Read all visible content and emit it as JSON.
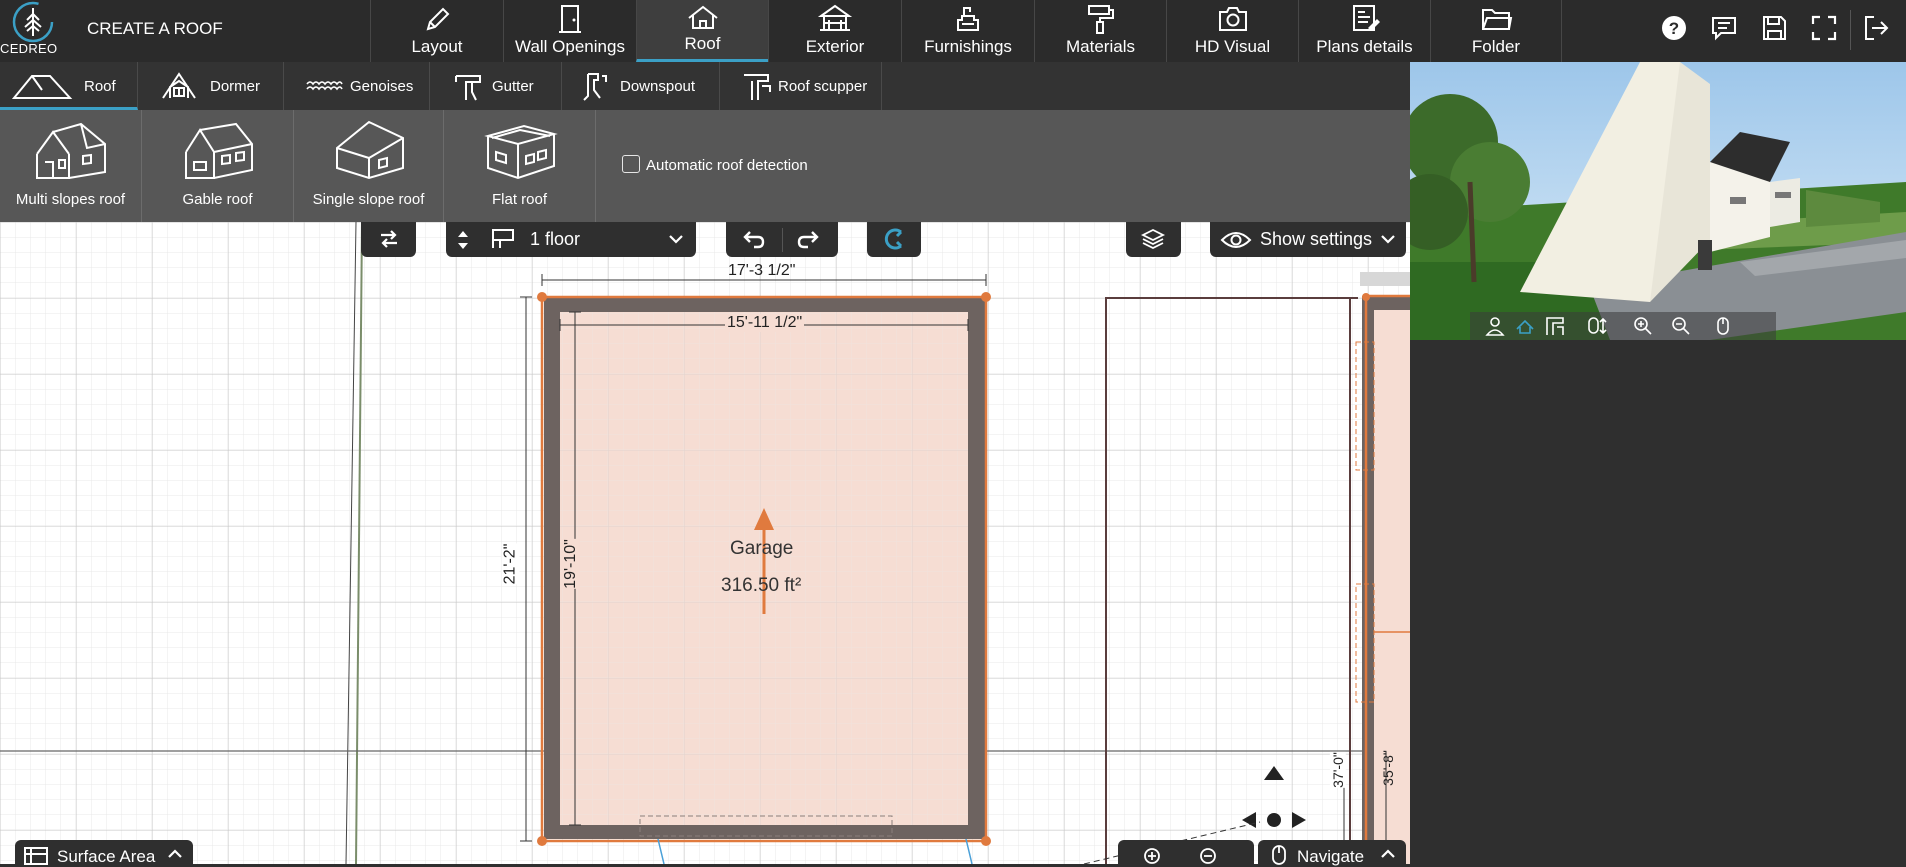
{
  "app": {
    "logo_text": "CEDREO",
    "title": "CREATE A ROOF"
  },
  "main_tabs": [
    {
      "label": "Layout",
      "icon": "pencil-icon"
    },
    {
      "label": "Wall Openings",
      "icon": "door-icon"
    },
    {
      "label": "Roof",
      "icon": "house-roof-icon",
      "active": true
    },
    {
      "label": "Exterior",
      "icon": "terrace-icon"
    },
    {
      "label": "Furnishings",
      "icon": "armchair-lamp-icon"
    },
    {
      "label": "Materials",
      "icon": "paint-roller-icon"
    },
    {
      "label": "HD Visual",
      "icon": "camera-icon"
    },
    {
      "label": "Plans details",
      "icon": "plans-icon"
    },
    {
      "label": "Folder",
      "icon": "folder-icon"
    }
  ],
  "toolbar_icons": [
    "help-icon",
    "comment-icon",
    "save-icon",
    "fullscreen-icon",
    "logout-icon"
  ],
  "sub_tabs": [
    {
      "label": "Roof",
      "icon": "roof-icon",
      "active": true
    },
    {
      "label": "Dormer",
      "icon": "dormer-icon"
    },
    {
      "label": "Genoises",
      "icon": "genoises-icon"
    },
    {
      "label": "Gutter",
      "icon": "gutter-icon"
    },
    {
      "label": "Downspout",
      "icon": "downspout-icon"
    },
    {
      "label": "Roof scupper",
      "icon": "roof-scupper-icon"
    }
  ],
  "roof_types": [
    {
      "label": "Multi slopes roof",
      "icon": "multi-slopes-roof-icon"
    },
    {
      "label": "Gable roof",
      "icon": "gable-roof-icon"
    },
    {
      "label": "Single slope roof",
      "icon": "single-slope-roof-icon"
    },
    {
      "label": "Flat roof",
      "icon": "flat-roof-icon"
    }
  ],
  "auto_detect": {
    "label": "Automatic roof detection",
    "checked": false
  },
  "canvas_controls": {
    "floor_select": "1 floor",
    "show_settings": "Show settings",
    "surface_area": "Surface Area",
    "navigate": "Navigate"
  },
  "plan": {
    "room_name": "Garage",
    "room_area": "316.50 ft²",
    "dim_top_outer": "17'-3 1/2\"",
    "dim_top_inner": "15'-11 1/2\"",
    "dim_left_outer": "21'-2\"",
    "dim_left_inner": "19'-10\"",
    "dim_right_a": "37'-0\"",
    "dim_right_b": "35'-8\""
  },
  "colors": {
    "accent": "#3ba0c6",
    "wall": "#6d6360",
    "room_fill": "#f6ddd3",
    "selection": "#e07a3e"
  }
}
